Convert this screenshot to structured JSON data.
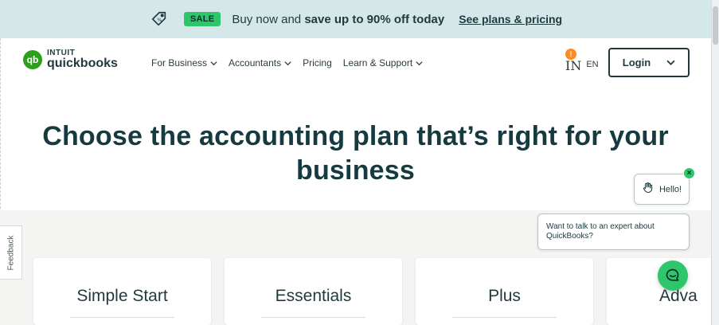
{
  "promo": {
    "sale_badge": "SALE",
    "message_prefix": "Buy now and ",
    "message_bold": "save up to 90% off today",
    "link": "See plans & pricing"
  },
  "logo": {
    "mark": "qb",
    "brand": "INTUIT",
    "product": "quickbooks"
  },
  "nav": {
    "items": [
      {
        "label": "For Business",
        "has_dropdown": true
      },
      {
        "label": "Accountants",
        "has_dropdown": true
      },
      {
        "label": "Pricing",
        "has_dropdown": false
      },
      {
        "label": "Learn & Support",
        "has_dropdown": true
      }
    ],
    "lang_badge": "!",
    "lang_icon_text": "IN",
    "lang_code": "EN",
    "login_label": "Login"
  },
  "hero": {
    "title": "Choose the accounting plan that’s right for your business"
  },
  "plans": [
    {
      "name": "Simple Start"
    },
    {
      "name": "Essentials"
    },
    {
      "name": "Plus"
    },
    {
      "name": "Adva"
    }
  ],
  "feedback_label": "Feedback",
  "chat": {
    "hello": "Hello!",
    "close": "×",
    "expert_prompt": "Want to talk to an expert about QuickBooks?"
  },
  "colors": {
    "promo_bg": "#d4e8e9",
    "sale_green": "#2ec66a",
    "brand_green": "#2ca01c",
    "heading_teal": "#153b40",
    "notification_orange": "#ff8a1e"
  }
}
